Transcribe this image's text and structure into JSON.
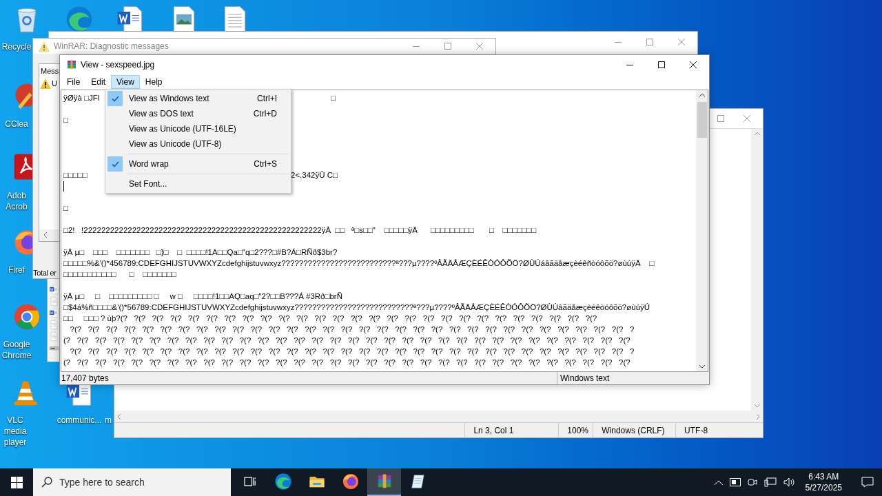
{
  "desktop_icons": [
    {
      "kind": "recycle",
      "label": "Recycle"
    },
    {
      "kind": "edge"
    },
    {
      "kind": "word"
    },
    {
      "kind": "image"
    },
    {
      "kind": "text"
    },
    {
      "kind": "ccleaner",
      "label": "CClea"
    },
    {
      "kind": "acrobat",
      "label": "Adob Acrob"
    },
    {
      "kind": "firefox",
      "label": "Firef"
    },
    {
      "kind": "chrome",
      "label": "Google Chrome"
    },
    {
      "kind": "vlc",
      "label": "VLC media player"
    },
    {
      "kind": "word",
      "label": "communic..."
    },
    {
      "label": "m"
    }
  ],
  "notepad": {
    "status": [
      "Ln 3, Col 1",
      "100%",
      "Windows (CRLF)",
      "UTF-8"
    ]
  },
  "diagnostic_window": {
    "title": "WinRAR: Diagnostic messages",
    "column_header": "Mess",
    "message": "U",
    "footer": "Total er"
  },
  "file_strip": [
    {
      "kind": "word"
    },
    {
      "kind": "doc"
    },
    {
      "kind": "word"
    },
    {
      "kind": "doc"
    },
    {
      "kind": "doc"
    },
    {
      "kind": "drive"
    }
  ],
  "viewer": {
    "title": "View - sexspeed.jpg",
    "menu": [
      {
        "label": "File",
        "selected": false
      },
      {
        "label": "Edit",
        "selected": false
      },
      {
        "label": "View",
        "selected": true
      },
      {
        "label": "Help",
        "selected": false
      }
    ],
    "lines": [
      {
        "kind": "text",
        "text": "ÿØÿà □JFI",
        "right": "□"
      },
      {
        "kind": "blank"
      },
      {
        "kind": "text",
        "text": "□"
      },
      {
        "kind": "blank"
      },
      {
        "kind": "blank"
      },
      {
        "kind": "blank"
      },
      {
        "kind": "blank"
      },
      {
        "kind": "text",
        "text": "□□□□□",
        "right": "2<.342ÿÛ C□"
      },
      {
        "kind": "caret"
      },
      {
        "kind": "blank"
      },
      {
        "kind": "text",
        "text": "□"
      },
      {
        "kind": "blank"
      },
      {
        "kind": "text",
        "text": "□2!   !222222222222222222222222222222222222222222222222222222ÿÀ  □□   ª□s□□\"    □□□□□ÿÄ      □□□□□□□□□       □    □□□□□□□"
      },
      {
        "kind": "blank"
      },
      {
        "kind": "text",
        "text": "ÿÄ µ□    □□□    □□□□□□□   □}□    □  □□□□!1A□□Qa□\"q□2???□#B?Á□RÑð$3br?"
      },
      {
        "kind": "text",
        "text": "□□□□□%&'()*456789:CDEFGHIJSTUVWXYZcdefghijstuvwxyz??????????????????????????ª???µ????ºÂÃÄÅÆÇÈÉÊÒÓÔÕÖ?ØÙÚáâãäåæçèéêñòóôõö?øùúÿÄ    □"
      },
      {
        "kind": "text",
        "text": "□□□□□□□□□□□      □    □□□□□□□"
      },
      {
        "kind": "blank"
      },
      {
        "kind": "text",
        "text": "ÿÄ µ□     □    □□□□□□□□□ □     w □     □□□□!1□□AQ□aq□\"2?□□B???Á #3Rð□brÑ"
      },
      {
        "kind": "text",
        "text": "□$4á%ñ□□□□&'()*56789:CDEFGHIJSTUVWXYZcdefghijstuvwxyz???????????????????????????ª???µ????ºÂÃÄÅÆÇÈÉÊÒÓÔÕÖ?ØÙÚâãäåæçèéêòóôõö?øùúÿÚ"
      },
      {
        "kind": "text",
        "text": "□□     □□□ ? ùþ?(?   ?(?   ?(?   ?(?   ?(?   ?(?   ?(?   ?(?   ?(?   ?(?   ?(?   ?(?   ?(?   ?(?   ?(?   ?(?   ?(?   ?(?   ?(?   ?(?   ?(?   ?(?   ?(?   ?(?   ?(?   ?(?   ?(?"
      },
      {
        "kind": "text",
        "text": "   ?(?   ?(?   ?(?   ?(?   ?(?   ?(?   ?(?   ?(?   ?(?   ?(?   ?(?   ?(?   ?(?   ?(?   ?(?   ?(?   ?(?   ?(?   ?(?   ?(?   ?(?   ?(?   ?(?   ?(?   ?(?   ?(?   ?(?   ?(?   ?(?   ?(?   ?(?   ?"
      },
      {
        "kind": "text",
        "text": "(?   ?(?   ?(?   ?(?   ?(?   ?(?   ?(?   ?(?   ?(?   ?(?   ?(?   ?(?   ?(?   ?(?   ?(?   ?(?   ?(?   ?(?   ?(?   ?(?   ?(?   ?(?   ?(?   ?(?   ?(?   ?(?   ?(?   ?(?   ?(?   ?(?   ?(?   ?(?"
      },
      {
        "kind": "text",
        "text": "   ?(?   ?(?   ?(?   ?(?   ?(?   ?(?   ?(?   ?(?   ?(?   ?(?   ?(?   ?(?   ?(?   ?(?   ?(?   ?(?   ?(?   ?(?   ?(?   ?(?   ?(?   ?(?   ?(?   ?(?   ?(?   ?(?   ?(?   ?(?   ?(?   ?(?   ?(?   ?"
      },
      {
        "kind": "text",
        "text": "(?   ?(?   ?(?   ?(?   ?(?   ?(?   ?(?   ?(?   ?(?   ?(?   ?(?   ?(?   ?(?   ?(?   ?(?   ?(?   ?(?   ?(?   ?(?   ?(?   ?(?   ?(?   ?(?   ?(?   ?(?   ?(?   ?(?   ?(?   ?(?   ?(?   ?(?   ?(?"
      }
    ],
    "status": [
      "17,407 bytes",
      "Windows text"
    ],
    "dropdown": [
      {
        "kind": "item",
        "label": "View as Windows text",
        "shortcut": "Ctrl+I",
        "checked": true
      },
      {
        "kind": "item",
        "label": "View as DOS text",
        "shortcut": "Ctrl+D",
        "checked": false
      },
      {
        "kind": "item",
        "label": "View as Unicode (UTF-16LE)",
        "checked": false
      },
      {
        "kind": "item",
        "label": "View as Unicode (UTF-8)",
        "checked": false
      },
      {
        "kind": "separator"
      },
      {
        "kind": "item",
        "label": "Word wrap",
        "shortcut": "Ctrl+S",
        "checked": true
      },
      {
        "kind": "separator"
      },
      {
        "kind": "item",
        "label": "Set Font...",
        "checked": false
      }
    ]
  },
  "taskbar": {
    "search_placeholder": "Type here to search",
    "apps": [
      {
        "kind": "taskview",
        "selected": false
      },
      {
        "kind": "edge",
        "selected": false
      },
      {
        "kind": "explorer",
        "selected": false
      },
      {
        "kind": "firefox",
        "selected": false
      },
      {
        "kind": "winrar",
        "selected": true
      },
      {
        "kind": "notepad",
        "selected": false
      }
    ],
    "time": "6:43 AM",
    "date": "5/27/2025"
  }
}
